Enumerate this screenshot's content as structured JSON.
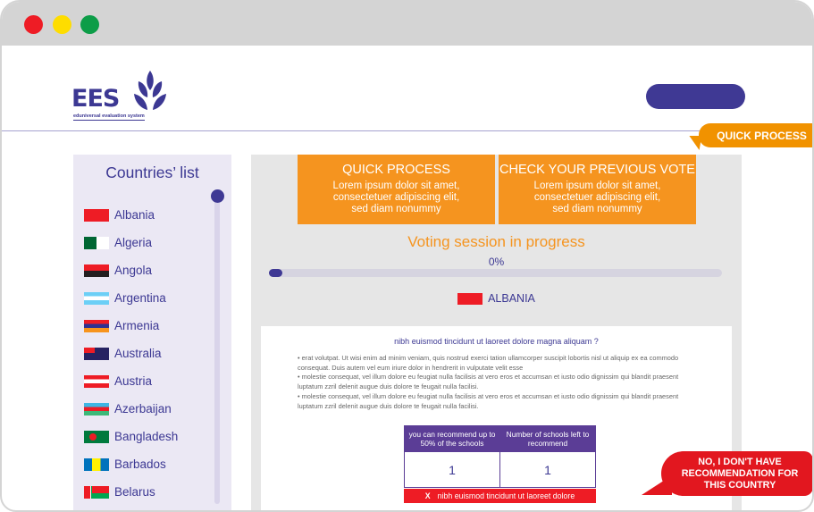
{
  "window": {
    "controls": [
      "close",
      "minimize",
      "maximize"
    ],
    "colors": {
      "close": "#ee1c25",
      "minimize": "#fedd00",
      "maximize": "#0d9d48"
    }
  },
  "header": {
    "logo_text": "EES",
    "logo_subtitle": "eduniversal evaluation system",
    "button_label": ""
  },
  "callouts": {
    "quick_process": "QUICK PROCESS",
    "no_recommendation": [
      "NO, I DON'T HAVE",
      "RECOMMENDATION FOR",
      "THIS COUNTRY"
    ]
  },
  "sidebar": {
    "title": "Countries’ list",
    "countries": [
      {
        "name": "Albania",
        "flag": "albania-flag"
      },
      {
        "name": "Algeria",
        "flag": "algeria-flag"
      },
      {
        "name": "Angola",
        "flag": "angola-flag"
      },
      {
        "name": "Argentina",
        "flag": "argentina-flag"
      },
      {
        "name": "Armenia",
        "flag": "armenia-flag"
      },
      {
        "name": "Australia",
        "flag": "australia-flag"
      },
      {
        "name": "Austria",
        "flag": "austria-flag"
      },
      {
        "name": "Azerbaijan",
        "flag": "azerbaijan-flag"
      },
      {
        "name": "Bangladesh",
        "flag": "bangladesh-flag"
      },
      {
        "name": "Barbados",
        "flag": "barbados-flag"
      },
      {
        "name": "Belarus",
        "flag": "belarus-flag"
      }
    ]
  },
  "main": {
    "cards": [
      {
        "title": "QUICK PROCESS",
        "desc": [
          "Lorem ipsum dolor sit amet,",
          "consectetuer adipiscing elit,",
          "sed diam nonummy"
        ]
      },
      {
        "title": "CHECK YOUR PREVIOUS VOTE",
        "desc": [
          "Lorem ipsum dolor sit amet,",
          "consectetuer adipiscing elit,",
          "sed diam nonummy"
        ]
      }
    ],
    "session_title": "Voting session in progress",
    "progress": {
      "label": "0%",
      "value": 0
    },
    "selected_country": "ALBANIA",
    "question": "nibh euismod tincidunt ut laoreet dolore magna aliquam ?",
    "bullets": [
      "• erat volutpat. Ut wisi enim ad minim veniam, quis nostrud exerci tation ullamcorper suscipit lobortis nisl ut aliquip ex ea commodo consequat. Duis autem vel eum iriure dolor in hendrerit in vulputate velit esse",
      "• molestie consequat, vel illum dolore eu feugiat nulla facilisis at vero eros et accumsan et iusto odio dignissim qui blandit praesent luptatum zzril delenit augue duis dolore te feugait nulla facilisi.",
      "• molestie consequat, vel illum dolore eu feugiat nulla facilisis at vero eros et accumsan et iusto odio dignissim qui blandit praesent luptatum zzril delenit augue duis dolore te feugait nulla facilisi."
    ],
    "table": {
      "headers": [
        "you can recommend up to 50% of the schools",
        "Number of schools left to recommend"
      ],
      "values": [
        "1",
        "1"
      ]
    },
    "error": {
      "icon": "X",
      "text": "nibh euismod tincidunt ut laoreet dolore"
    }
  },
  "colors": {
    "brand_purple": "#3f3994",
    "accent_orange": "#f5941f",
    "alert_red": "#e2171f"
  }
}
